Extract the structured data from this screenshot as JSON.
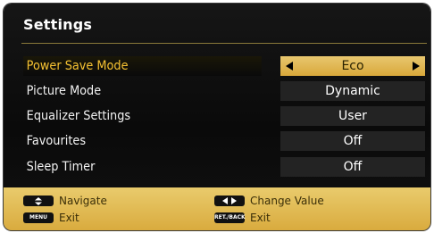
{
  "settings": {
    "title": "Settings",
    "rows": [
      {
        "label": "Power Save Mode",
        "value": "Eco"
      },
      {
        "label": "Picture Mode",
        "value": "Dynamic"
      },
      {
        "label": "Equalizer Settings",
        "value": "User"
      },
      {
        "label": "Favourites",
        "value": "Off"
      },
      {
        "label": "Sleep Timer",
        "value": "Off"
      }
    ],
    "selected_index": 0
  },
  "footer": {
    "navigate": {
      "key": "up-down-arrows-icon",
      "label": "Navigate"
    },
    "change": {
      "key": "left-right-arrows-icon",
      "label": "Change Value"
    },
    "menu_exit": {
      "key": "MENU",
      "label": "Exit"
    },
    "back_exit": {
      "key": "RET./BACK",
      "label": "Exit"
    }
  },
  "colors": {
    "selected_text": "#f6c232",
    "footer_gold": "#e3bd55"
  }
}
